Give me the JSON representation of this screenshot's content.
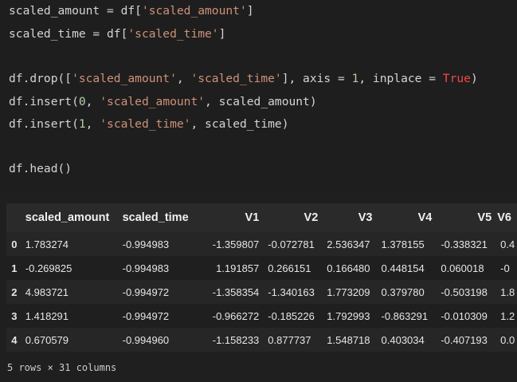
{
  "code": {
    "l1": {
      "a": "scaled_amount = df[",
      "b": "'scaled_amount'",
      "c": "]"
    },
    "l2": {
      "a": "scaled_time = df[",
      "b": "'scaled_time'",
      "c": "]"
    },
    "l3": {
      "a": "df.drop([",
      "b": "'scaled_amount'",
      "c": ", ",
      "d": "'scaled_time'",
      "e": "], axis = ",
      "f": "1",
      "g": ", inplace = ",
      "h": "True",
      "i": ")"
    },
    "l4": {
      "a": "df.insert(",
      "b": "0",
      "c": ", ",
      "d": "'scaled_amount'",
      "e": ", scaled_amount)"
    },
    "l5": {
      "a": "df.insert(",
      "b": "1",
      "c": ", ",
      "d": "'scaled_time'",
      "e": ", scaled_time)"
    },
    "l6": {
      "a": "df.head()"
    }
  },
  "table": {
    "headers": [
      "",
      "scaled_amount",
      "scaled_time",
      "V1",
      "V2",
      "V3",
      "V4",
      "V5",
      "V6"
    ],
    "rows": [
      [
        "0",
        "1.783274",
        "-0.994983",
        "-1.359807",
        "-0.072781",
        "2.536347",
        "1.378155",
        "-0.338321",
        "0.4"
      ],
      [
        "1",
        "-0.269825",
        "-0.994983",
        "1.191857",
        "0.266151",
        "0.166480",
        "0.448154",
        "0.060018",
        "-0"
      ],
      [
        "2",
        "4.983721",
        "-0.994972",
        "-1.358354",
        "-1.340163",
        "1.773209",
        "0.379780",
        "-0.503198",
        "1.8"
      ],
      [
        "3",
        "1.418291",
        "-0.994972",
        "-0.966272",
        "-0.185226",
        "1.792993",
        "-0.863291",
        "-0.010309",
        "1.2"
      ],
      [
        "4",
        "0.670579",
        "-0.994960",
        "-1.158233",
        "0.877737",
        "1.548718",
        "0.403034",
        "-0.407193",
        "0.0"
      ]
    ]
  },
  "shape_info": "5 rows × 31 columns",
  "colors": {
    "background": "#1e1e1e",
    "string": "#ce9178",
    "number": "#b5cea8",
    "keyword": "#f44747"
  }
}
